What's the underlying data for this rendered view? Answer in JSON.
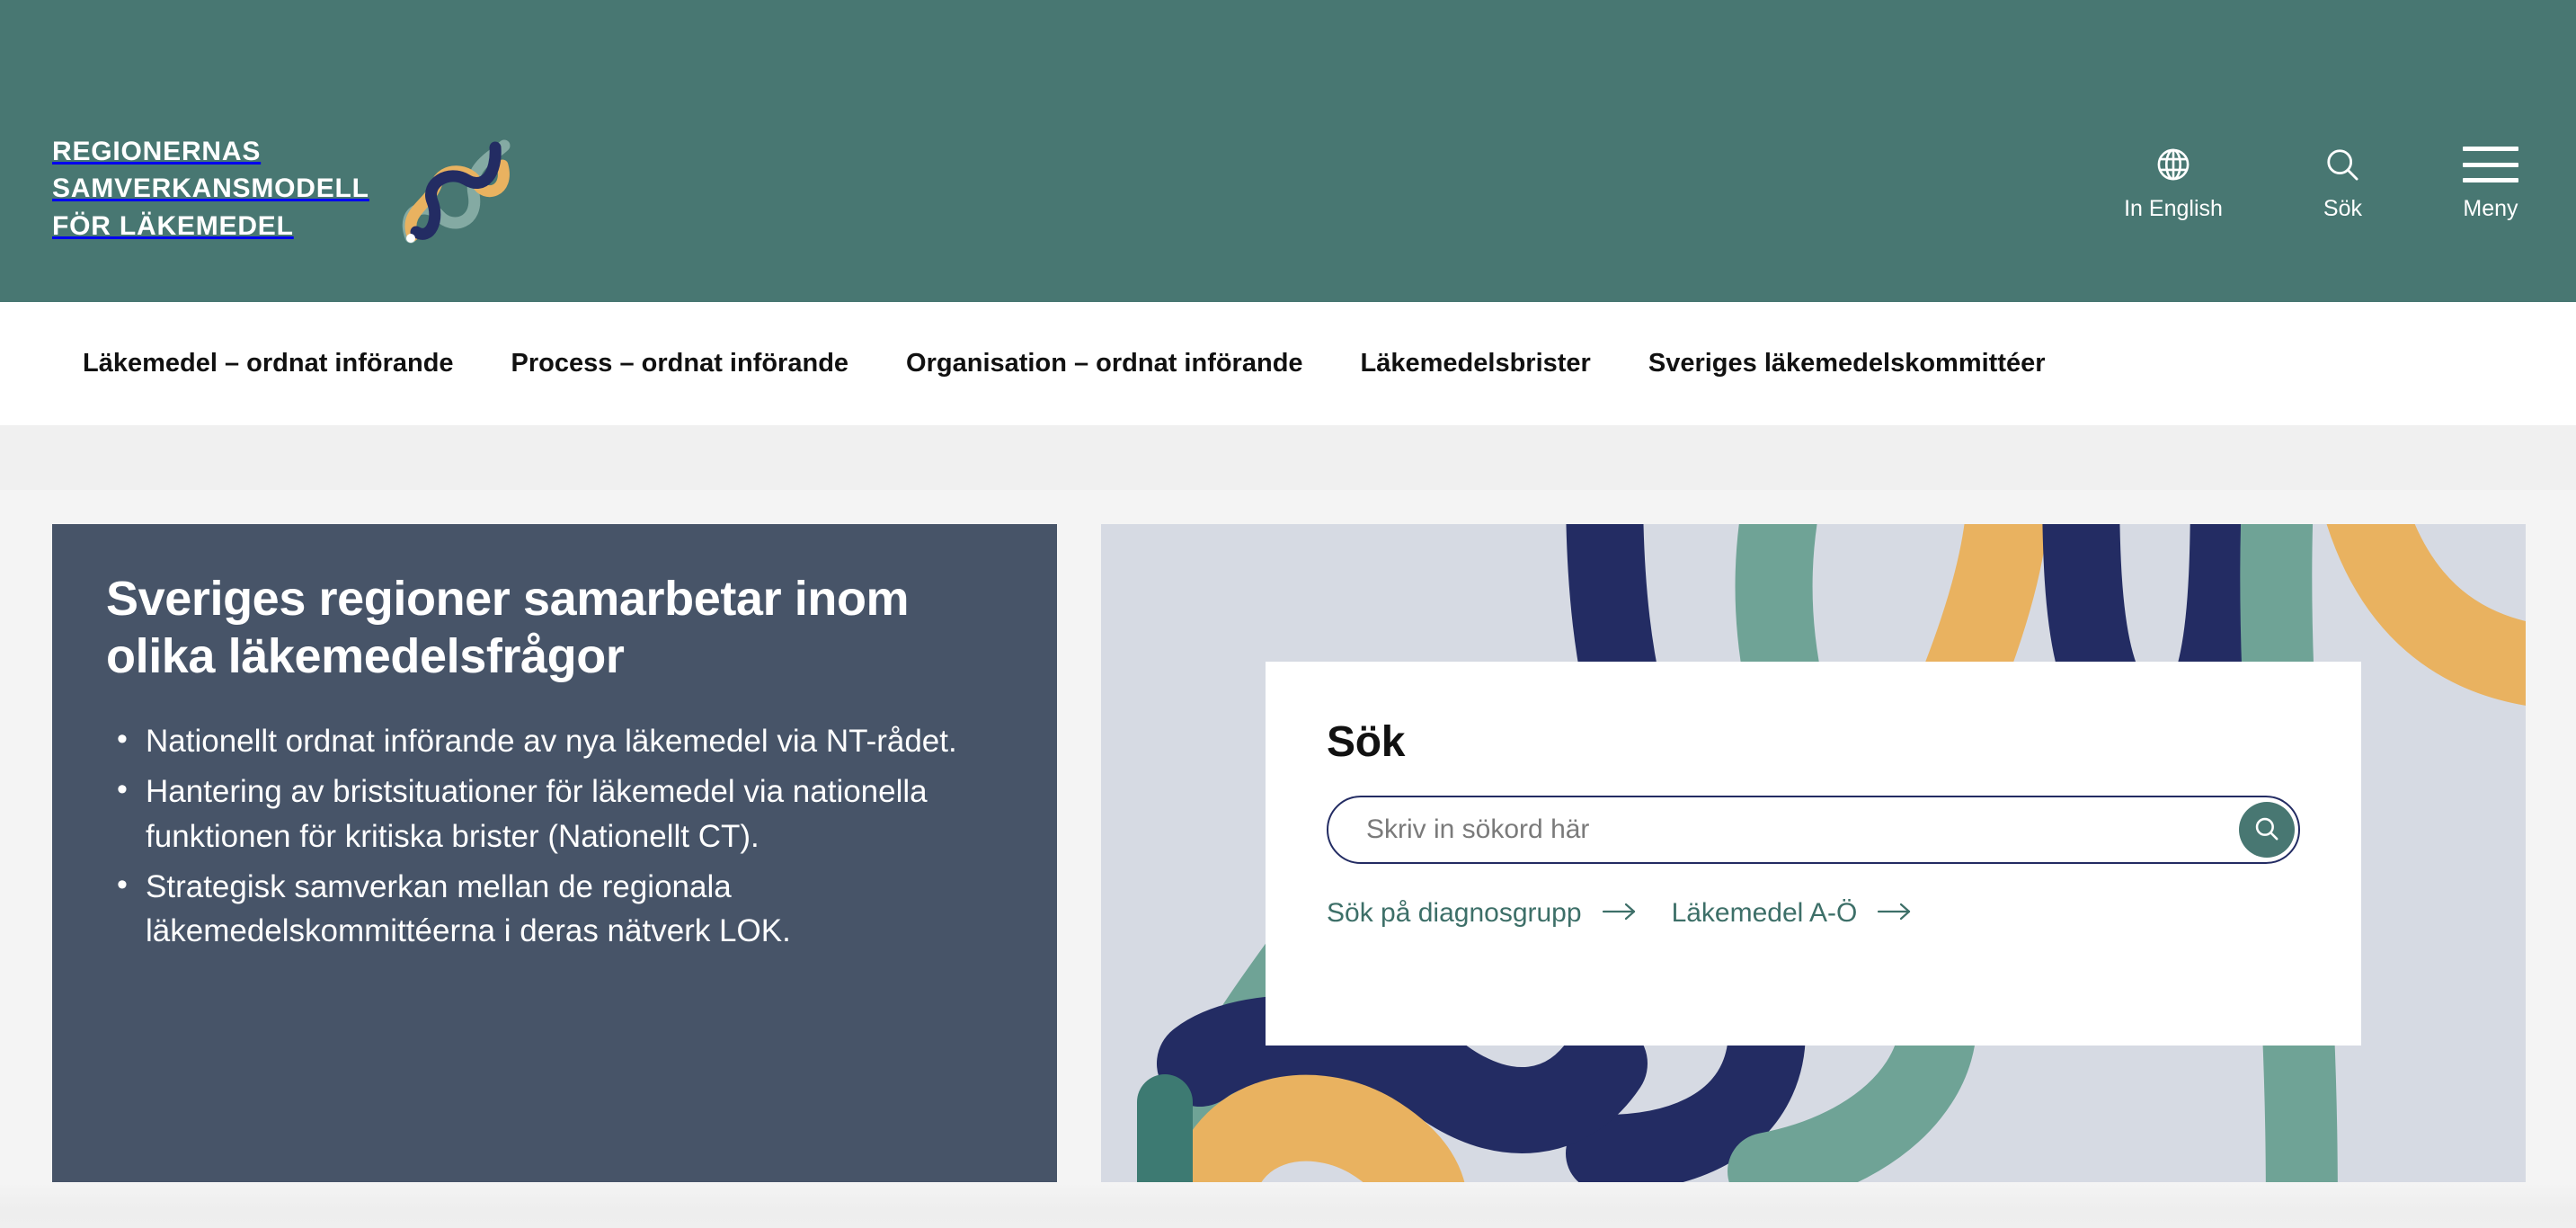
{
  "colors": {
    "header_teal": "#487772",
    "nav_text": "#111111",
    "intro_card_bg": "#475468",
    "hero_bg": "#d6dae3",
    "accent_navy": "#232c63",
    "accent_gold": "#e9b260",
    "accent_green": "#6fa396",
    "link_green": "#3d6f68"
  },
  "header": {
    "brand_name": "REGIONERNAS\nSAMVERKANSMODELL\nFÖR LÄKEMEDEL",
    "brand_logo_icon": "dna-helix-icon",
    "actions": [
      {
        "label": "In English",
        "icon": "globe-icon",
        "name": "language-switch"
      },
      {
        "label": "Sök",
        "icon": "search-icon",
        "name": "header-search"
      },
      {
        "label": "Meny",
        "icon": "hamburger-icon",
        "name": "header-menu"
      }
    ]
  },
  "nav": {
    "items": [
      "Läkemedel – ordnat införande",
      "Process – ordnat införande",
      "Organisation – ordnat införande",
      "Läkemedelsbrister",
      "Sveriges läkemedelskommittéer"
    ]
  },
  "intro": {
    "title": "Sveriges regioner samarbetar inom olika läkemedelsfrågor",
    "bullets": [
      "Nationellt ordnat införande av nya läkemedel via NT-rådet.",
      "Hantering av bristsituationer för läkemedel via nationella funktionen för kritiska brister (Nationellt CT).",
      "Strategisk samverkan mellan de regionala läkemedelskommittéerna i deras nätverk LOK."
    ]
  },
  "search": {
    "heading": "Sök",
    "placeholder": "Skriv in sökord här",
    "value": "",
    "submit_icon": "search-icon",
    "quick_links": [
      {
        "label": "Sök på diagnosgrupp",
        "icon": "arrow-right-icon"
      },
      {
        "label": "Läkemedel A-Ö",
        "icon": "arrow-right-icon"
      }
    ]
  }
}
